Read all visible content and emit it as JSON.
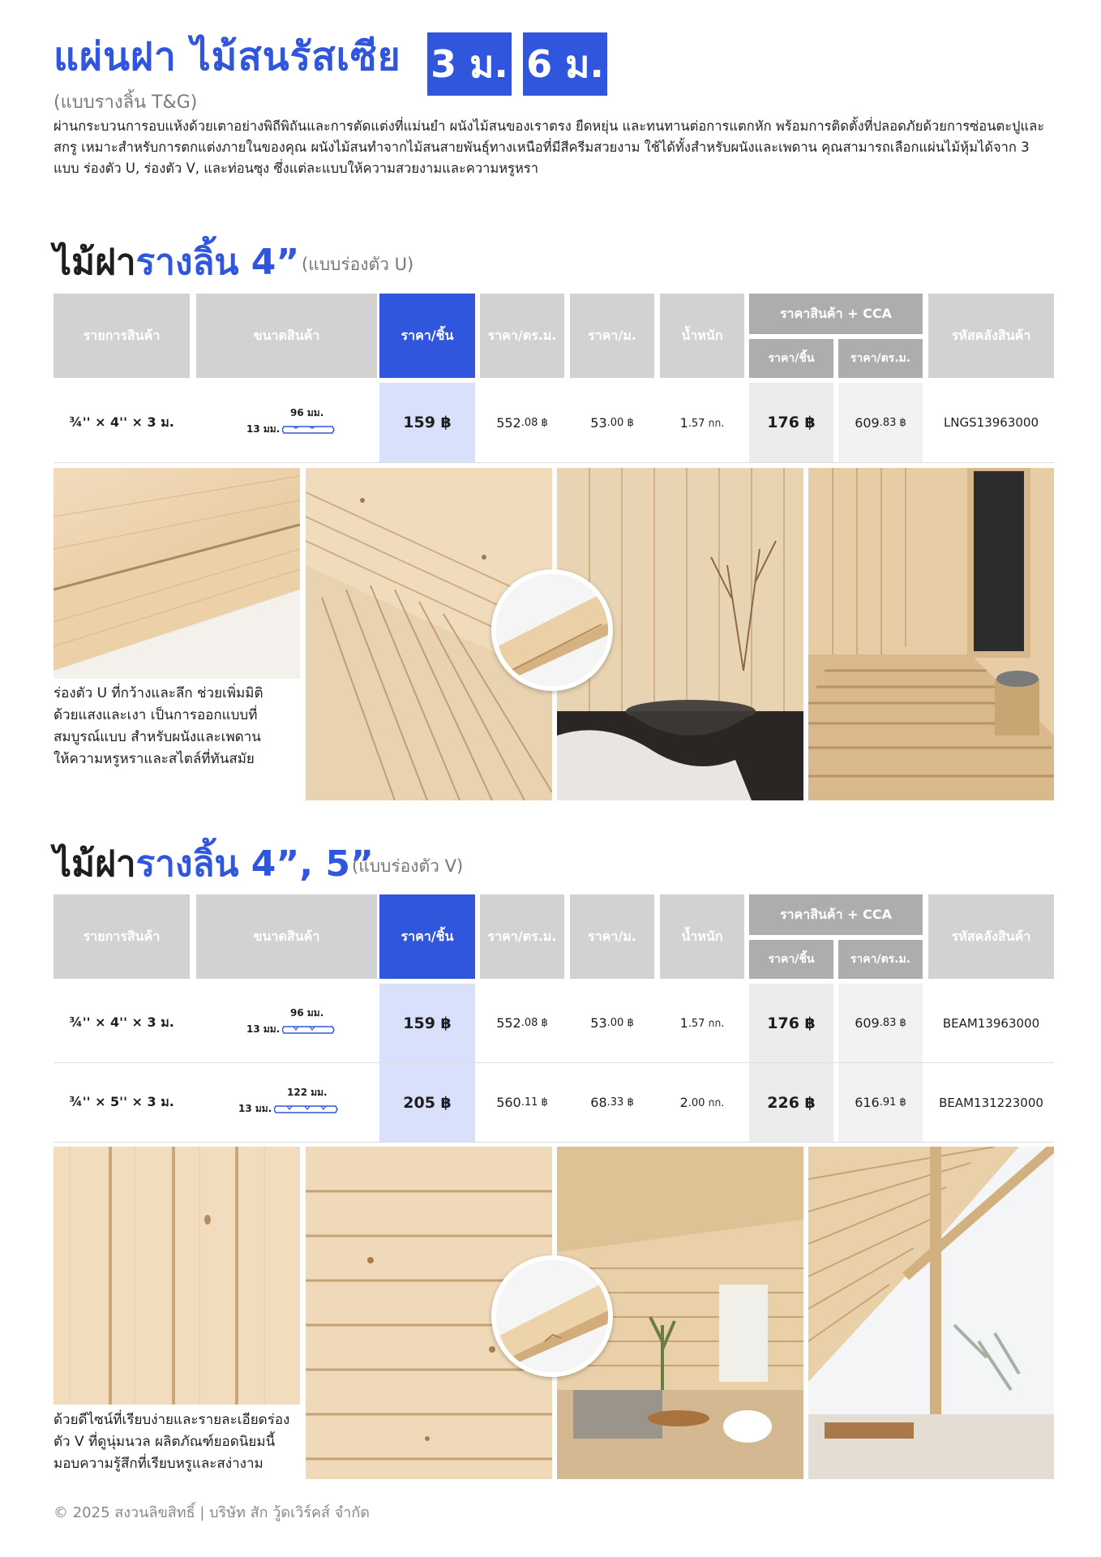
{
  "header": {
    "title": "แผ่นฝา ไม้สนรัสเซีย",
    "badge_3m": "3 ม.",
    "badge_6m": "6 ม.",
    "subtitle": "(แบบรางลิ้น T&G)",
    "intro": "ผ่านกระบวนการอบแห้งด้วยเตาอย่างพิถีพิถันและการตัดแต่งที่แม่นยำ ผนังไม้สนของเราตรง ยืดหยุ่น และทนทานต่อการแตกหัก พร้อมการติดตั้งที่ปลอดภัยด้วยการซ่อนตะปูและสกรู เหมาะสำหรับการตกแต่งภายในของคุณ ผนังไม้สนทำจากไม้สนสายพันธุ์ทางเหนือที่มีสีครีมสวยงาม ใช้ได้ทั้งสำหรับผนังและเพดาน คุณสามารถเลือกแผ่นไม้หุ้มได้จาก 3 แบบ ร่องตัว U, ร่องตัว V, และท่อนซุง ซึ่งแต่ละแบบให้ความสวยงามและความหรูหรา"
  },
  "table_headers": {
    "item": "รายการสินค้า",
    "size": "ขนาดสินค้า",
    "price_piece": "ราคา/ชิ้น",
    "price_sqm": "ราคา/ตร.ม.",
    "price_m": "ราคา/ม.",
    "weight": "น้ำหนัก",
    "cca_group": "ราคาสินค้า + CCA",
    "cca_piece": "ราคา/ชิ้น",
    "cca_sqm": "ราคา/ตร.ม.",
    "sku": "รหัสคลังสินค้า"
  },
  "section_u": {
    "title_plain": "ไม้ฝา",
    "title_accent": "รางลิ้น 4”",
    "subtitle": "(แบบร่องตัว U)",
    "rows": [
      {
        "item": "¾'' × 4'' × 3 ม.",
        "width": "96 มม.",
        "thickness": "13 มม.",
        "price_piece": "159 ฿",
        "price_sqm_int": "552",
        "price_sqm_dec": ".08 ฿",
        "price_m_int": "53",
        "price_m_dec": ".00 ฿",
        "weight_int": "1",
        "weight_dec": ".57 กก.",
        "cca_piece": "176 ฿",
        "cca_sqm_int": "609",
        "cca_sqm_dec": ".83 ฿",
        "sku": "LNGS13963000"
      }
    ],
    "caption": "ร่องตัว U ที่กว้างและลึก ช่วยเพิ่มมิติด้วยแสงและเงา เป็นการออกแบบที่สมบูรณ์แบบ สำหรับผนังและเพดาน ให้ความหรูหราและสไตล์ที่ทันสมัย"
  },
  "section_v": {
    "title_plain": "ไม้ฝา",
    "title_accent": "รางลิ้น 4”, 5”",
    "subtitle": "(แบบร่องตัว V)",
    "rows": [
      {
        "item": "¾'' × 4'' × 3 ม.",
        "width": "96 มม.",
        "thickness": "13 มม.",
        "price_piece": "159 ฿",
        "price_sqm_int": "552",
        "price_sqm_dec": ".08 ฿",
        "price_m_int": "53",
        "price_m_dec": ".00 ฿",
        "weight_int": "1",
        "weight_dec": ".57 กก.",
        "cca_piece": "176 ฿",
        "cca_sqm_int": "609",
        "cca_sqm_dec": ".83 ฿",
        "sku": "BEAM13963000"
      },
      {
        "item": "¾'' × 5'' × 3 ม.",
        "width": "122 มม.",
        "thickness": "13 มม.",
        "price_piece": "205 ฿",
        "price_sqm_int": "560",
        "price_sqm_dec": ".11 ฿",
        "price_m_int": "68",
        "price_m_dec": ".33 ฿",
        "weight_int": "2",
        "weight_dec": ".00 กก.",
        "cca_piece": "226 ฿",
        "cca_sqm_int": "616",
        "cca_sqm_dec": ".91 ฿",
        "sku": "BEAM131223000"
      }
    ],
    "caption": "ด้วยดีไซน์ที่เรียบง่ายและรายละเอียดร่องตัว V ที่ดูนุ่มนวล ผลิตภัณฑ์ยอดนิยมนี้มอบความรู้สึกที่เรียบหรูและสง่างาม"
  },
  "footer": "© 2025 สงวนลิขสิทธิ์ | บริษัท สัก วู้ดเวิร์คส์ จำกัด",
  "colors": {
    "accent": "#2f56dd",
    "header_grey": "#d2d2d2",
    "price_highlight": "#d8e0fb"
  }
}
